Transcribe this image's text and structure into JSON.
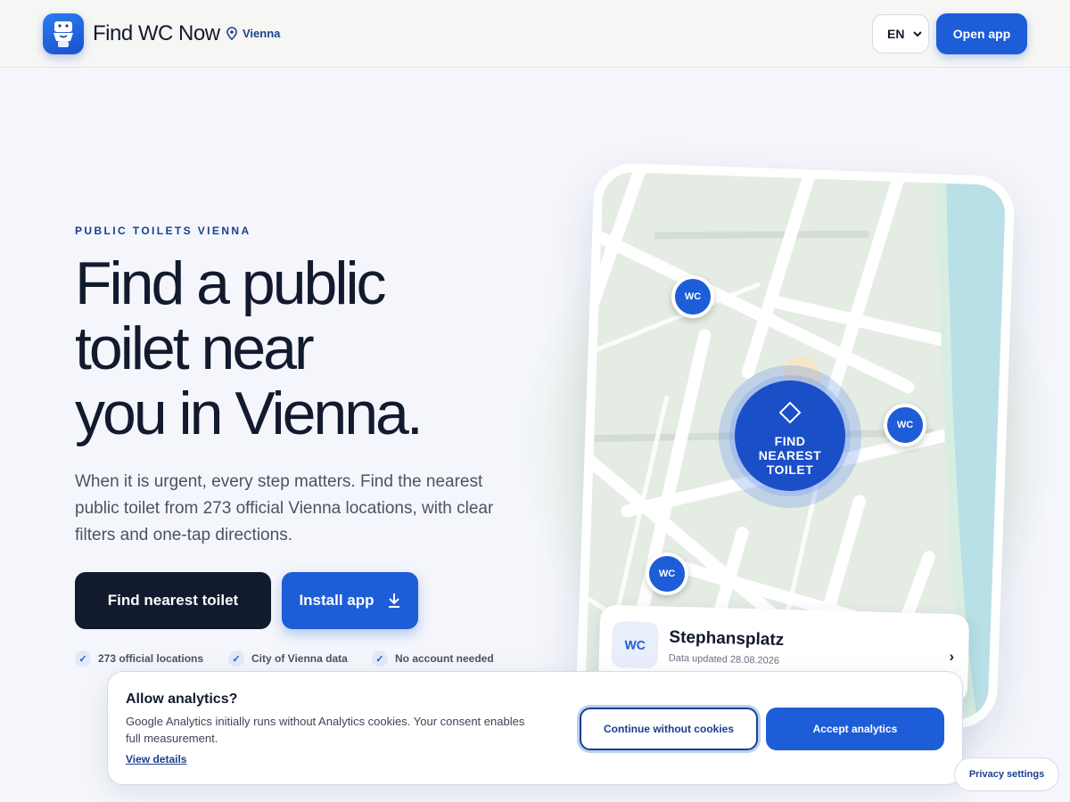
{
  "header": {
    "brand": "Find WC Now",
    "city": "Vienna",
    "language": "EN",
    "open_app": "Open app"
  },
  "hero": {
    "eyebrow": "PUBLIC TOILETS VIENNA",
    "headline": [
      "Find a public",
      "toilet near",
      "you in Vienna."
    ],
    "lead": "When it is urgent, every step matters. Find the nearest public toilet from 273 official Vienna locations, with clear filters and one-tap directions.",
    "primary_cta": "Find nearest toilet",
    "install_cta": "Install app",
    "trust": [
      "273 official locations",
      "City of Vienna data",
      "No account needed"
    ]
  },
  "mockup": {
    "pin_label": "WC",
    "find_button": [
      "FIND",
      "NEAREST",
      "TOILET"
    ],
    "card": {
      "badge": "WC",
      "name": "Stephansplatz",
      "updated": "Data updated 28.08.2026",
      "chevron": "›"
    }
  },
  "cookie": {
    "title": "Allow analytics?",
    "text": "Google Analytics initially runs without Analytics cookies. Your consent enables full measurement.",
    "details": "View details",
    "continue": "Continue without cookies",
    "accept": "Accept analytics"
  },
  "privacy_settings": "Privacy settings",
  "colors": {
    "accent": "#1d5dd8",
    "ink": "#121a2e",
    "link": "#1a3f8f",
    "river": "#b9e0e6",
    "map": "#e4ece4"
  }
}
